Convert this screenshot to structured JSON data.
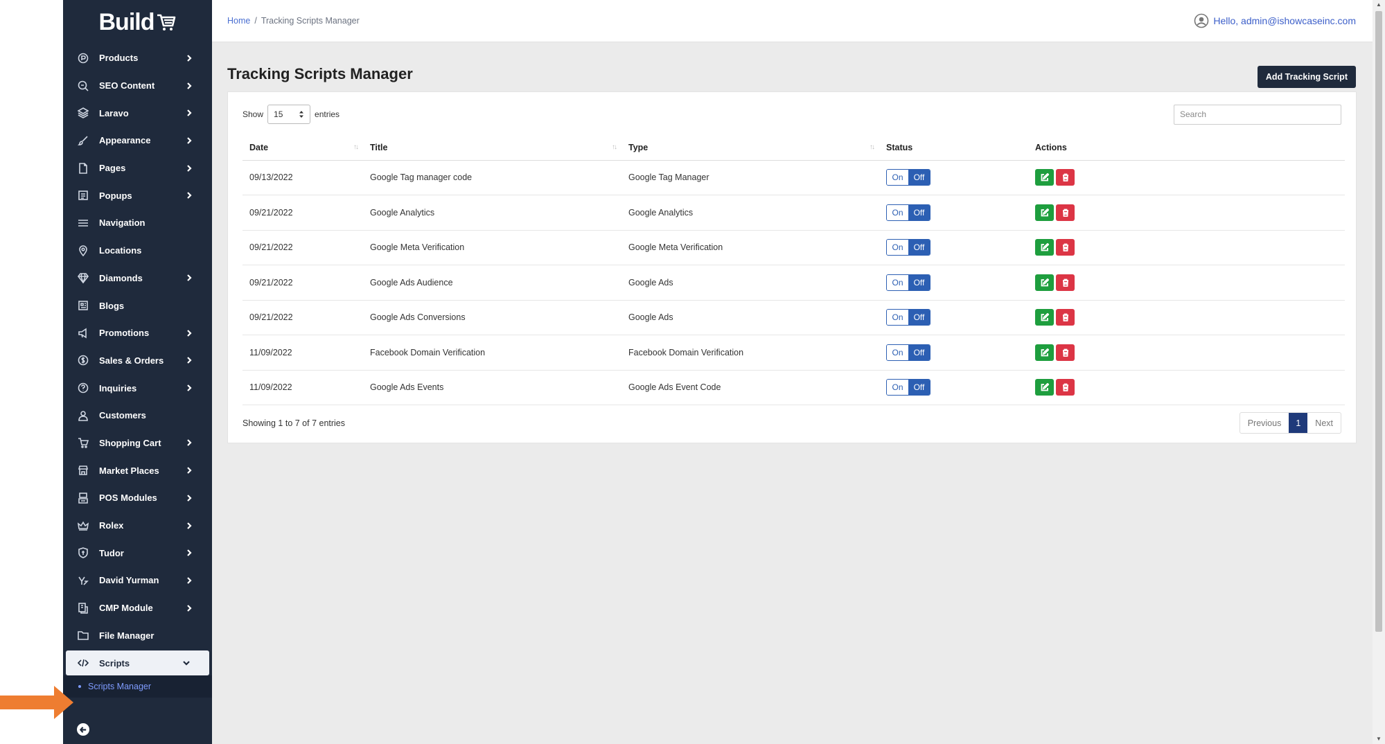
{
  "brand": {
    "name": "Build"
  },
  "sidebar": {
    "items": [
      {
        "label": "Products",
        "icon": "products-icon",
        "chevron": true
      },
      {
        "label": "SEO Content",
        "icon": "seo-icon",
        "chevron": true
      },
      {
        "label": "Laravo",
        "icon": "laravo-icon",
        "chevron": true
      },
      {
        "label": "Appearance",
        "icon": "brush-icon",
        "chevron": true
      },
      {
        "label": "Pages",
        "icon": "page-icon",
        "chevron": true
      },
      {
        "label": "Popups",
        "icon": "popup-icon",
        "chevron": true
      },
      {
        "label": "Navigation",
        "icon": "menu-icon",
        "chevron": false
      },
      {
        "label": "Locations",
        "icon": "location-icon",
        "chevron": false
      },
      {
        "label": "Diamonds",
        "icon": "diamond-icon",
        "chevron": true
      },
      {
        "label": "Blogs",
        "icon": "blog-icon",
        "chevron": false
      },
      {
        "label": "Promotions",
        "icon": "megaphone-icon",
        "chevron": true
      },
      {
        "label": "Sales & Orders",
        "icon": "dollar-icon",
        "chevron": true
      },
      {
        "label": "Inquiries",
        "icon": "question-icon",
        "chevron": true
      },
      {
        "label": "Customers",
        "icon": "user-icon",
        "chevron": false
      },
      {
        "label": "Shopping Cart",
        "icon": "cart-icon",
        "chevron": true
      },
      {
        "label": "Market Places",
        "icon": "store-icon",
        "chevron": true
      },
      {
        "label": "POS Modules",
        "icon": "pos-icon",
        "chevron": true
      },
      {
        "label": "Rolex",
        "icon": "crown-icon",
        "chevron": true
      },
      {
        "label": "Tudor",
        "icon": "shield-icon",
        "chevron": true
      },
      {
        "label": "David Yurman",
        "icon": "dy-icon",
        "chevron": true
      },
      {
        "label": "CMP Module",
        "icon": "cmp-icon",
        "chevron": true
      },
      {
        "label": "File Manager",
        "icon": "folder-icon",
        "chevron": false
      }
    ],
    "active": {
      "label": "Scripts",
      "icon": "code-icon"
    },
    "subitem": {
      "label": "Scripts Manager"
    }
  },
  "topbar": {
    "breadcrumb_home": "Home",
    "breadcrumb_sep": "/",
    "breadcrumb_current": "Tracking Scripts Manager",
    "user_greeting": "Hello, admin@ishowcaseinc.com"
  },
  "page": {
    "title": "Tracking Scripts Manager",
    "add_button": "Add Tracking Script"
  },
  "table_controls": {
    "show_label": "Show",
    "entries_value": "15",
    "entries_label": "entries",
    "search_placeholder": "Search"
  },
  "table": {
    "columns": [
      "Date",
      "Title",
      "Type",
      "Status",
      "Actions"
    ],
    "toggle_on": "On",
    "toggle_off": "Off",
    "rows": [
      {
        "date": "09/13/2022",
        "title": "Google Tag manager code",
        "type": "Google Tag Manager"
      },
      {
        "date": "09/21/2022",
        "title": "Google Analytics",
        "type": "Google Analytics"
      },
      {
        "date": "09/21/2022",
        "title": "Google Meta Verification",
        "type": "Google Meta Verification"
      },
      {
        "date": "09/21/2022",
        "title": "Google Ads Audience",
        "type": "Google Ads"
      },
      {
        "date": "09/21/2022",
        "title": "Google Ads Conversions",
        "type": "Google Ads"
      },
      {
        "date": "11/09/2022",
        "title": "Facebook Domain Verification",
        "type": "Facebook Domain Verification"
      },
      {
        "date": "11/09/2022",
        "title": "Google Ads Events",
        "type": "Google Ads Event Code"
      }
    ]
  },
  "footer": {
    "info": "Showing 1 to 7 of 7 entries",
    "prev": "Previous",
    "page": "1",
    "next": "Next"
  },
  "colors": {
    "sidebar_bg": "#1f2a3c",
    "accent_blue": "#2c5fb3",
    "edit_green": "#1e9e3e",
    "delete_red": "#dc3545",
    "arrow_orange": "#ee7d31"
  }
}
